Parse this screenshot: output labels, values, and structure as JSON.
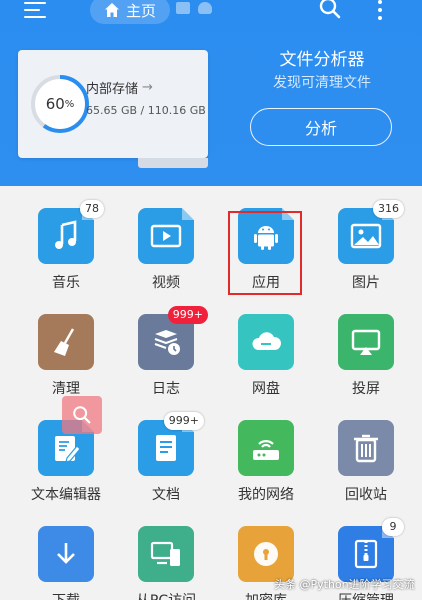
{
  "header": {
    "home_tab_label": "主页",
    "analyzer_title": "文件分析器",
    "analyzer_subtitle": "发现可清理文件",
    "analyze_button": "分析"
  },
  "storage": {
    "title": "内部存储",
    "percent_value": "60",
    "percent_sign": "%",
    "used_fraction": 0.6,
    "size_text": "65.65 GB / 110.16 GB"
  },
  "apps": [
    {
      "label": "音乐",
      "badge": "78",
      "icon": "music-icon",
      "color": "#2a9de6"
    },
    {
      "label": "视频",
      "badge": "",
      "icon": "video-icon",
      "color": "#2a9de6"
    },
    {
      "label": "应用",
      "badge": "",
      "icon": "android-icon",
      "color": "#2a9de6"
    },
    {
      "label": "图片",
      "badge": "316",
      "icon": "image-icon",
      "color": "#2a9de6"
    },
    {
      "label": "清理",
      "badge": "",
      "icon": "broom-icon",
      "color": "#a57a5a"
    },
    {
      "label": "日志",
      "badge": "999+",
      "icon": "log-icon",
      "color": "#6a7a9a"
    },
    {
      "label": "网盘",
      "badge": "",
      "icon": "cloud-icon",
      "color": "#36c4c0"
    },
    {
      "label": "投屏",
      "badge": "",
      "icon": "cast-icon",
      "color": "#3bb56b"
    },
    {
      "label": "文本编辑器",
      "badge": "",
      "icon": "edit-icon",
      "color": "#2a9de6"
    },
    {
      "label": "文档",
      "badge": "999+",
      "icon": "document-icon",
      "color": "#2a9de6"
    },
    {
      "label": "我的网络",
      "badge": "",
      "icon": "network-icon",
      "color": "#43b85c"
    },
    {
      "label": "回收站",
      "badge": "",
      "icon": "trash-icon",
      "color": "#7a8aa8"
    },
    {
      "label": "下载",
      "badge": "",
      "icon": "download-icon",
      "color": "#3d8be6"
    },
    {
      "label": "从PC访问",
      "badge": "",
      "icon": "pc-access-icon",
      "color": "#3fae8a"
    },
    {
      "label": "加密库",
      "badge": "",
      "icon": "lock-icon",
      "color": "#e7a33a"
    },
    {
      "label": "压缩管理",
      "badge": "9",
      "icon": "zip-icon",
      "color": "#2f7ee6"
    }
  ],
  "colors": {
    "header": "#2e8ff0",
    "ring_progress": "#2a8ef0",
    "highlight": "#e22a2a",
    "red_badge": "#f0213a"
  },
  "watermark": "头条 @Python进阶学习交流"
}
